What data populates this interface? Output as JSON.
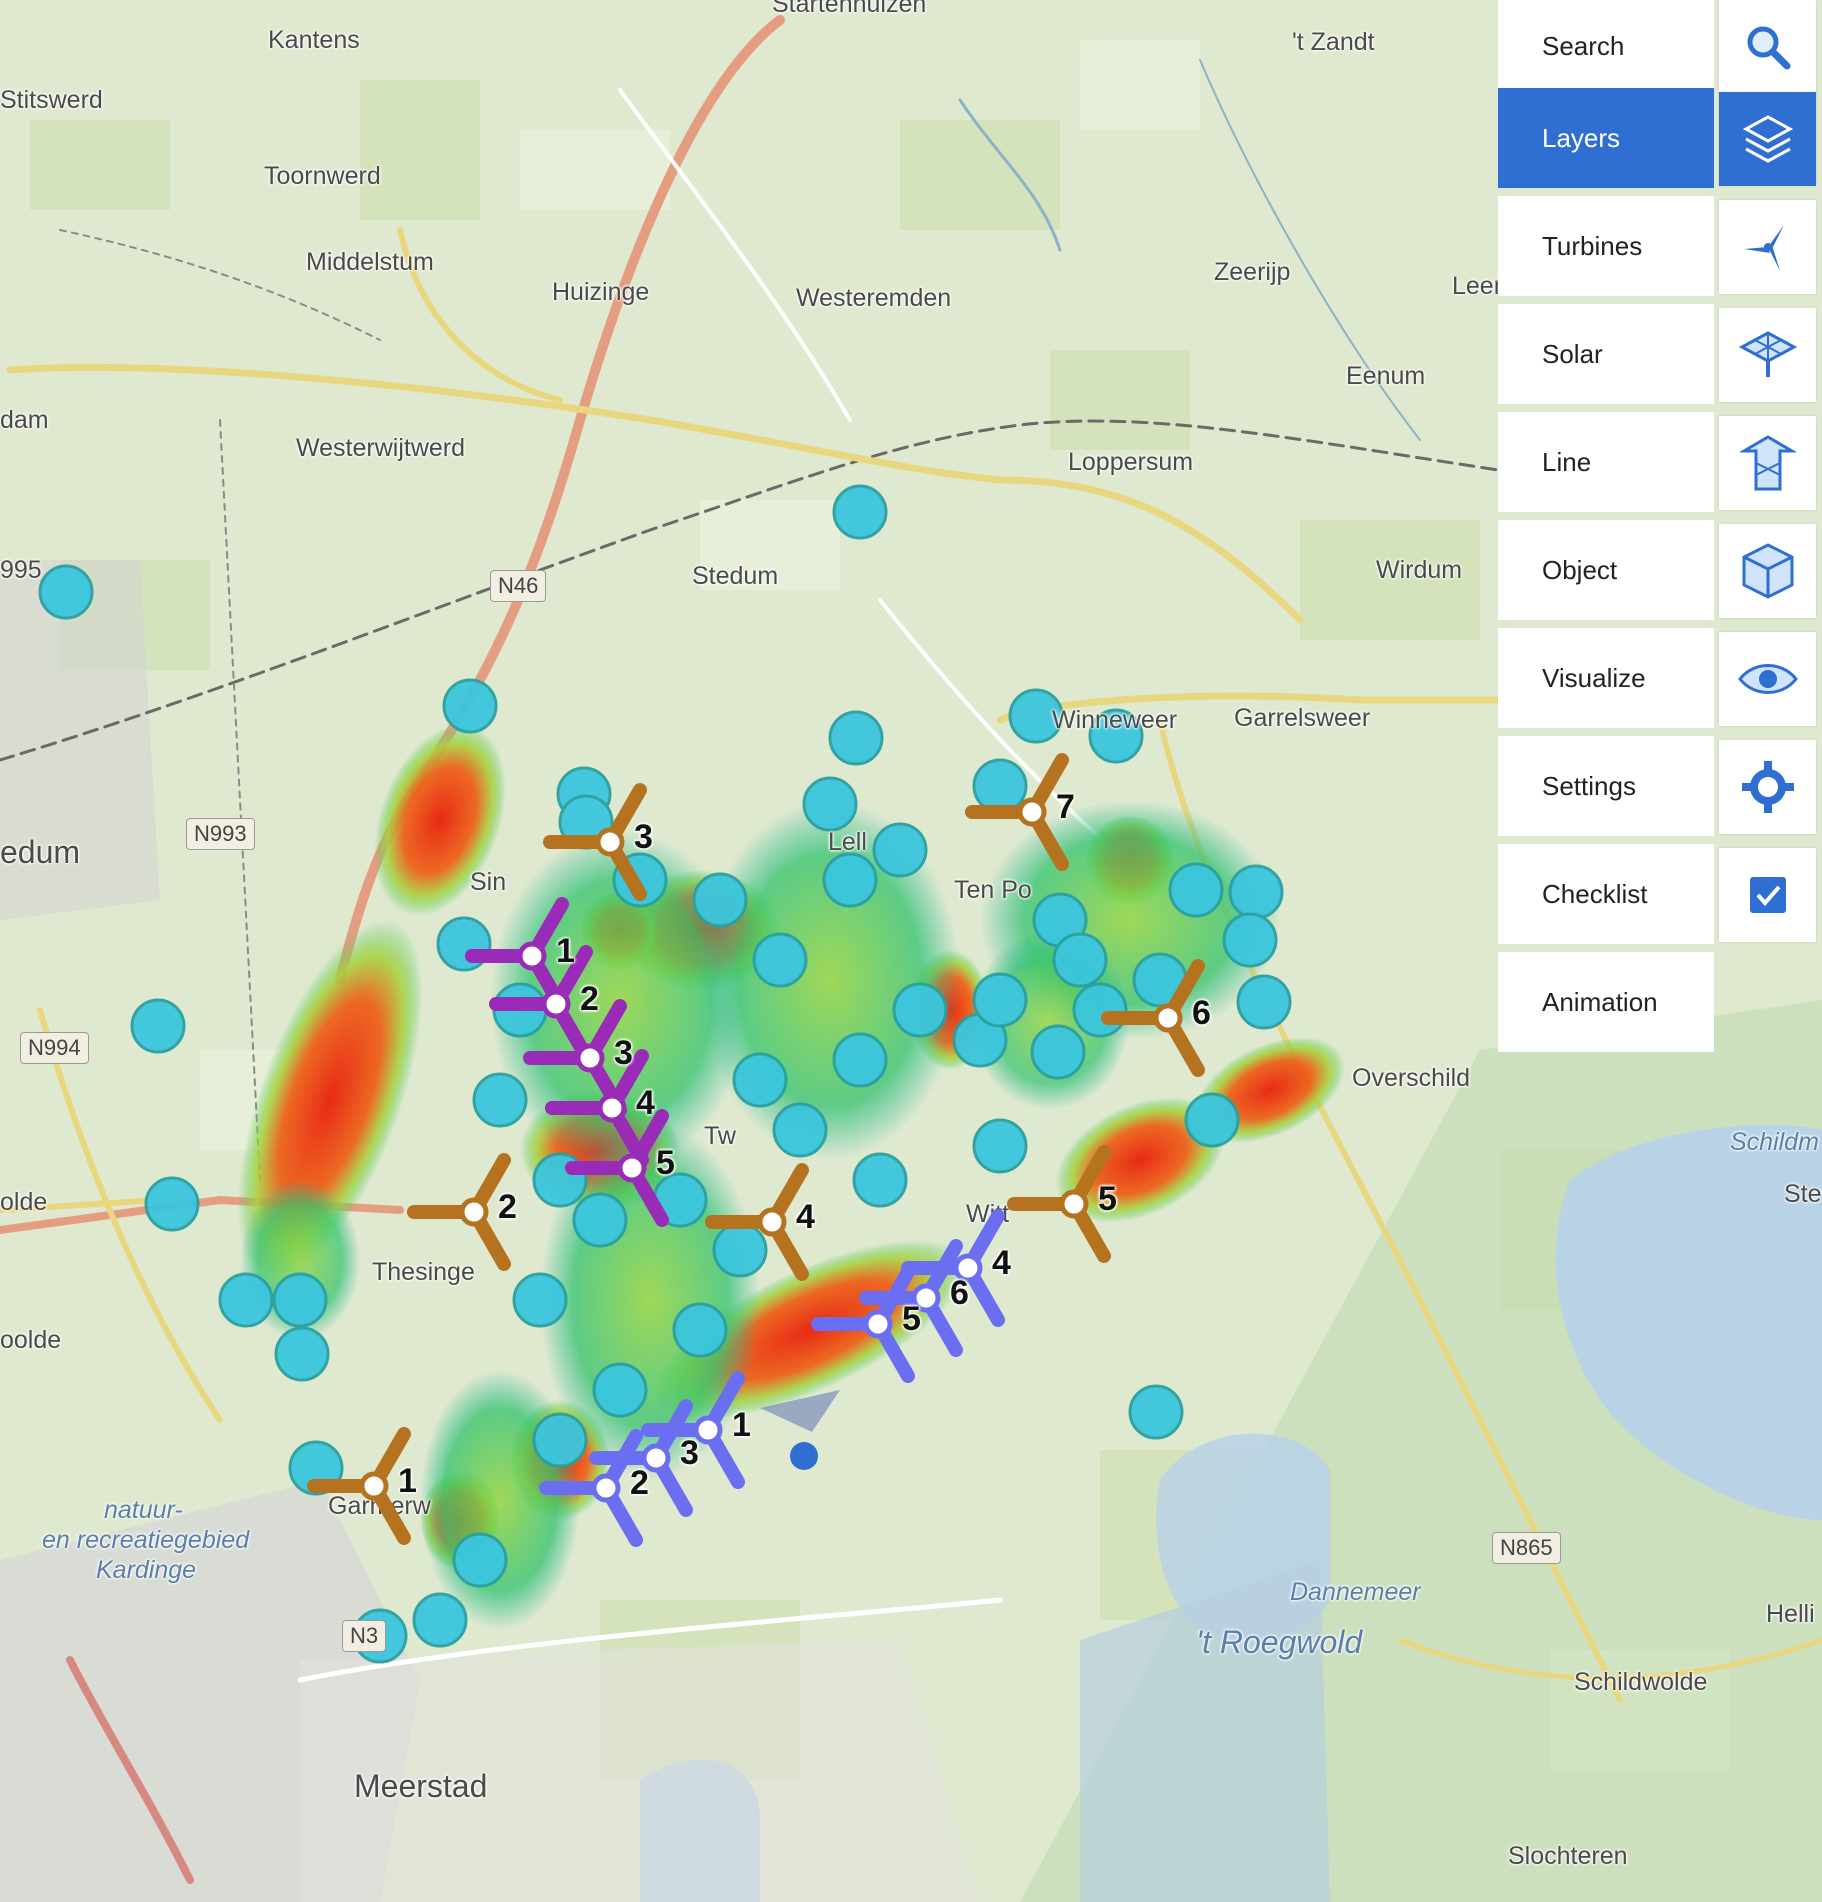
{
  "map": {
    "places": [
      {
        "name": "Startenhuizen",
        "big": false
      },
      {
        "name": "Kantens",
        "big": false
      },
      {
        "name": "Stitswerd",
        "big": false
      },
      {
        "name": "'t Zandt",
        "big": false
      },
      {
        "name": "Toornwerd",
        "big": false
      },
      {
        "name": "Middelstum",
        "big": false
      },
      {
        "name": "Huizinge",
        "big": false
      },
      {
        "name": "Westeremden",
        "big": false
      },
      {
        "name": "Zeerijp",
        "big": false
      },
      {
        "name": "Leer",
        "big": false
      },
      {
        "name": "Eenum",
        "big": false
      },
      {
        "name": "dam",
        "big": false
      },
      {
        "name": "Westerwijtwerd",
        "big": false
      },
      {
        "name": "Loppersum",
        "big": false
      },
      {
        "name": "Stedum",
        "big": false
      },
      {
        "name": "Wirdum",
        "big": false
      },
      {
        "name": "995",
        "big": false
      },
      {
        "name": "Garrelsweer",
        "big": false
      },
      {
        "name": "Winneweer",
        "big": false
      },
      {
        "name": "edum",
        "big": true
      },
      {
        "name": "Sin",
        "big": false
      },
      {
        "name": "Lell",
        "big": false
      },
      {
        "name": "Ten Po",
        "big": false
      },
      {
        "name": "Overschild",
        "big": false
      },
      {
        "name": "Thesinge",
        "big": false
      },
      {
        "name": "olde",
        "big": false
      },
      {
        "name": "oolde",
        "big": false
      },
      {
        "name": "Garmerw",
        "big": false
      },
      {
        "name": "Meerstad",
        "big": false
      },
      {
        "name": "Schildwolde",
        "big": false
      },
      {
        "name": "Slochteren",
        "big": false
      },
      {
        "name": "Helli",
        "big": false
      },
      {
        "name": "Ste",
        "big": false
      },
      {
        "name": "Tw",
        "big": false
      },
      {
        "name": "Witt",
        "big": false
      }
    ],
    "water_labels": [
      "natuur-",
      "en recreatiegebied",
      "Kardinge",
      "Dannemeer",
      "'t Roegwold",
      "Schildm"
    ],
    "road_shields": [
      "N46",
      "N993",
      "N994",
      "N865",
      "N3"
    ],
    "turbine_groups": [
      {
        "color": "#b5731f",
        "numbers": [
          "3",
          "2",
          "4",
          "1",
          "7",
          "6",
          "5"
        ]
      },
      {
        "color": "#9a2bb8",
        "numbers": [
          "1",
          "2",
          "3",
          "4",
          "5"
        ]
      },
      {
        "color": "#6b6ef0",
        "numbers": [
          "2",
          "3",
          "1",
          "5",
          "6",
          "4"
        ]
      }
    ]
  },
  "panel": {
    "items": [
      {
        "label": "Search",
        "icon": "search-icon",
        "active": false
      },
      {
        "label": "Layers",
        "icon": "layers-icon",
        "active": true
      },
      {
        "label": "Turbines",
        "icon": "turbine-icon",
        "active": false
      },
      {
        "label": "Solar",
        "icon": "solar-icon",
        "active": false
      },
      {
        "label": "Line",
        "icon": "line-icon",
        "active": false
      },
      {
        "label": "Object",
        "icon": "object-icon",
        "active": false
      },
      {
        "label": "Visualize",
        "icon": "eye-icon",
        "active": false
      },
      {
        "label": "Settings",
        "icon": "gear-icon",
        "active": false
      },
      {
        "label": "Checklist",
        "icon": "checkbox-icon",
        "active": false
      },
      {
        "label": "Animation",
        "icon": "",
        "active": false
      }
    ],
    "accent": "#2f6fd1"
  }
}
